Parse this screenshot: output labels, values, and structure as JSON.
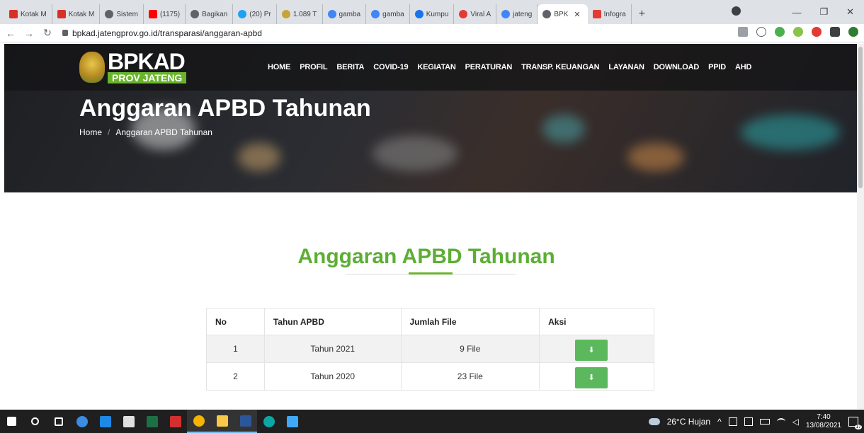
{
  "browser": {
    "tabs": [
      {
        "label": "Kotak M",
        "color": "#d93025"
      },
      {
        "label": "Kotak M",
        "color": "#d93025"
      },
      {
        "label": "Sistem",
        "color": "#5f6368"
      },
      {
        "label": "(1175)",
        "color": "#ff0000"
      },
      {
        "label": "Bagikan",
        "color": "#5f6368"
      },
      {
        "label": "(20) Pr",
        "color": "#1da1f2"
      },
      {
        "label": "1.089 T",
        "color": "#c7a43a"
      },
      {
        "label": "gamba",
        "color": "#4285f4"
      },
      {
        "label": "gamba",
        "color": "#4285f4"
      },
      {
        "label": "Kumpu",
        "color": "#1a73e8"
      },
      {
        "label": "Viral A",
        "color": "#e53935"
      },
      {
        "label": "jateng",
        "color": "#4285f4"
      },
      {
        "label": "BPK",
        "color": "#5f6368",
        "active": true
      },
      {
        "label": "Infogra",
        "color": "#e53935"
      }
    ],
    "url": "bpkad.jatengprov.go.id/transparasi/anggaran-apbd"
  },
  "site": {
    "logo_main": "BPKAD",
    "logo_sub": "PROV JATENG",
    "menu": [
      "HOME",
      "PROFIL",
      "BERITA",
      "COVID-19",
      "KEGIATAN",
      "PERATURAN",
      "TRANSP. KEUANGAN",
      "LAYANAN",
      "DOWNLOAD",
      "PPID",
      "AHD"
    ],
    "hero_title": "Anggaran APBD Tahunan",
    "breadcrumb": {
      "home": "Home",
      "separator": "/",
      "current": "Anggaran APBD Tahunan"
    }
  },
  "main": {
    "section_title": "Anggaran APBD Tahunan",
    "table": {
      "headers": [
        "No",
        "Tahun APBD",
        "Jumlah File",
        "Aksi"
      ],
      "rows": [
        {
          "no": "1",
          "tahun": "Tahun 2021",
          "jumlah": "9 File"
        },
        {
          "no": "2",
          "tahun": "Tahun 2020",
          "jumlah": "23 File"
        }
      ]
    }
  },
  "taskbar": {
    "weather": "26°C Hujan",
    "time": "7:40",
    "date": "13/08/2021",
    "notifications": "17"
  },
  "colors": {
    "accent_green": "#5dae34",
    "button_green": "#5cb85c"
  }
}
